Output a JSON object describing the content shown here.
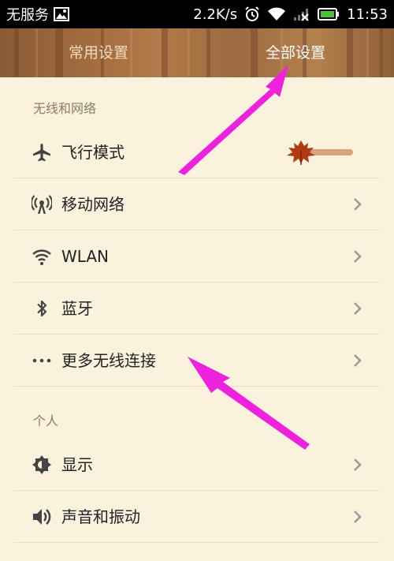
{
  "status_bar": {
    "carrier": "无服务",
    "speed": "2.2K/s",
    "time": "11:53"
  },
  "tabs": [
    {
      "label": "常用设置",
      "selected": false
    },
    {
      "label": "全部设置",
      "selected": true
    }
  ],
  "sections": [
    {
      "header": "无线和网络",
      "items": [
        {
          "label": "飞行模式",
          "icon": "airplane-icon",
          "control": "toggle"
        },
        {
          "label": "移动网络",
          "icon": "signal-tower-icon",
          "control": "chevron"
        },
        {
          "label": "WLAN",
          "icon": "wifi-icon",
          "control": "chevron"
        },
        {
          "label": "蓝牙",
          "icon": "bluetooth-icon",
          "control": "chevron"
        },
        {
          "label": "更多无线连接",
          "icon": "more-dots-icon",
          "control": "chevron"
        }
      ]
    },
    {
      "header": "个人",
      "items": [
        {
          "label": "显示",
          "icon": "brightness-icon",
          "control": "chevron"
        },
        {
          "label": "声音和振动",
          "icon": "speaker-icon",
          "control": "chevron"
        }
      ]
    }
  ],
  "colors": {
    "background": "#fbf2dd",
    "header": "#a06a3e",
    "annotation_arrow": "#ee22dd",
    "toggle_leaf": "#b03a12",
    "toggle_track": "#d9a27a"
  }
}
